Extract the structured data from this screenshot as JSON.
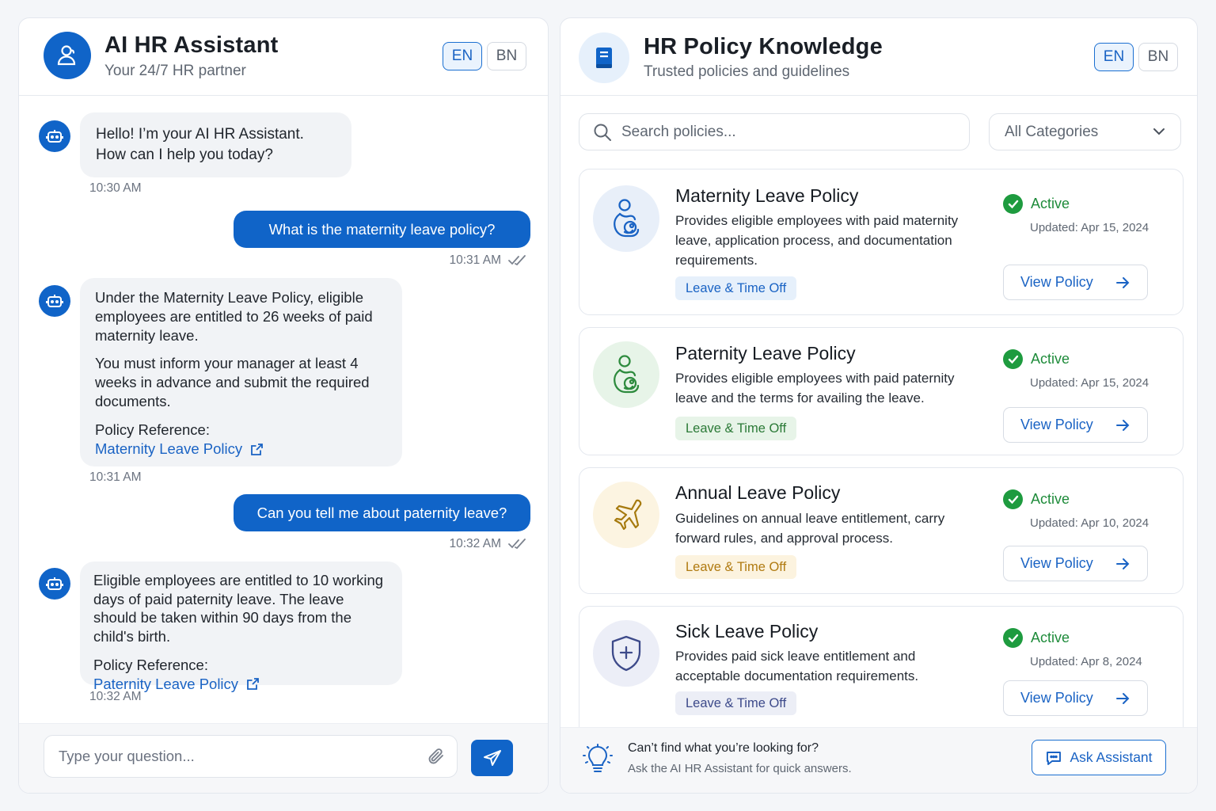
{
  "chat": {
    "title": "AI HR Assistant",
    "subtitle": "Your 24/7 HR partner",
    "lang": {
      "en": "EN",
      "bn": "BN",
      "active": "EN"
    },
    "messages": {
      "m1": {
        "line1": "Hello! I’m your AI HR Assistant.",
        "line2": "How can I help you today?",
        "time": "10:30 AM"
      },
      "m2": {
        "text": "What is the maternity leave policy?",
        "time": "10:31 AM"
      },
      "m3": {
        "p1": "Under the Maternity Leave Policy, eligible employees are entitled to 26 weeks of paid maternity leave.",
        "p2": "You must inform your manager at least 4 weeks in advance and submit the required documents.",
        "ref_label": "Policy Reference:",
        "ref_link": "Maternity Leave Policy",
        "time": "10:31 AM"
      },
      "m4": {
        "text": "Can you tell me about paternity leave?",
        "time": "10:32 AM"
      },
      "m5": {
        "p1": "Eligible employees are entitled to 10 working days of paid paternity leave. The leave should be taken within 90 days from the child's birth.",
        "ref_label": "Policy Reference:",
        "ref_link": "Paternity Leave Policy",
        "time": "10:32 AM"
      }
    },
    "composer": {
      "placeholder": "Type your question..."
    }
  },
  "kb": {
    "title": "HR Policy Knowledge",
    "subtitle": "Trusted policies and guidelines",
    "lang": {
      "en": "EN",
      "bn": "BN",
      "active": "EN"
    },
    "search_placeholder": "Search policies...",
    "category_select": "All Categories",
    "cards": [
      {
        "title": "Maternity Leave Policy",
        "desc": "Provides eligible employees with paid maternity leave, application process, and documentation requirements.",
        "tag": "Leave & Time Off",
        "status": "Active",
        "updated": "Updated: Apr 15, 2024",
        "button": "View Policy",
        "icon": "mother-baby-icon",
        "color": "#1a63c4"
      },
      {
        "title": "Paternity Leave Policy",
        "desc": "Provides eligible employees with paid paternity leave and the terms for availing the leave.",
        "tag": "Leave & Time Off",
        "status": "Active",
        "updated": "Updated: Apr 15, 2024",
        "button": "View Policy",
        "icon": "parent-baby-icon",
        "color": "#2e8b3e"
      },
      {
        "title": "Annual Leave Policy",
        "desc": "Guidelines on annual leave entitlement, carry forward rules, and approval process.",
        "tag": "Leave & Time Off",
        "status": "Active",
        "updated": "Updated: Apr 10, 2024",
        "button": "View Policy",
        "icon": "airplane-icon",
        "color": "#b8860b"
      },
      {
        "title": "Sick Leave Policy",
        "desc": "Provides paid sick leave entitlement and acceptable documentation requirements.",
        "tag": "Leave & Time Off",
        "status": "Active",
        "updated": "Updated: Apr 8, 2024",
        "button": "View Policy",
        "icon": "shield-plus-icon",
        "color": "#3d4a8a"
      }
    ],
    "footer": {
      "line1": "Can’t find what you’re looking for?",
      "line2": "Ask the AI HR Assistant for quick answers.",
      "button": "Ask Assistant"
    }
  }
}
